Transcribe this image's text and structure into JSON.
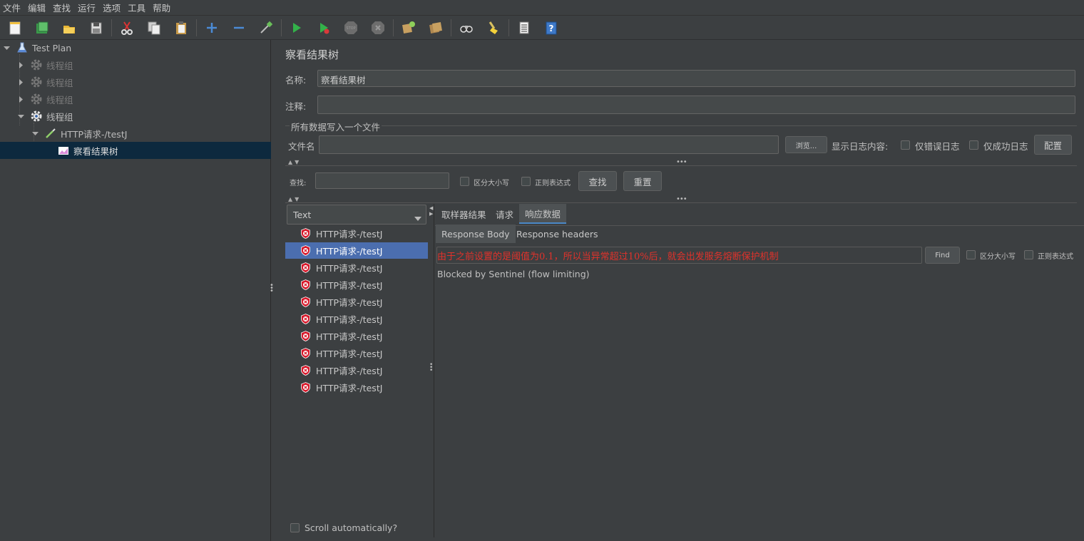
{
  "menu": [
    "文件",
    "编辑",
    "查找",
    "运行",
    "选项",
    "工具",
    "帮助"
  ],
  "toolbar_icons": [
    "new-icon",
    "templates-icon",
    "open-icon",
    "save-icon",
    "cut-icon",
    "copy-icon",
    "paste-icon",
    "expand-icon",
    "collapse-icon",
    "toggle-icon",
    "start-icon",
    "start-no-pause-icon",
    "stop-icon",
    "shutdown-icon",
    "clear-icon",
    "clear-all-icon",
    "search-icon",
    "reset-search-icon",
    "function-helper-icon",
    "help-icon"
  ],
  "tree": {
    "root": "Test Plan",
    "items": [
      {
        "label": "线程组",
        "disabled": true
      },
      {
        "label": "线程组",
        "disabled": true
      },
      {
        "label": "线程组",
        "disabled": true
      },
      {
        "label": "线程组",
        "disabled": false
      },
      {
        "label": "HTTP请求-/testJ",
        "disabled": false
      },
      {
        "label": "察看结果树",
        "disabled": false
      }
    ]
  },
  "panel": {
    "title": "察看结果树",
    "name_label": "名称:",
    "name_value": "察看结果树",
    "comment_label": "注释:",
    "comment_value": "",
    "file_section": "所有数据写入一个文件",
    "filename_label": "文件名",
    "filename_value": "",
    "browse_button": "浏览...",
    "log_label": "显示日志内容:",
    "errors_only": "仅错误日志",
    "success_only": "仅成功日志",
    "config_button": "配置",
    "search_label": "查找:",
    "search_value": "",
    "case_sensitive": "区分大小写",
    "regex": "正则表达式",
    "find_button": "查找",
    "reset_button": "重置",
    "renderer": "Text",
    "scroll_auto": "Scroll automatically?"
  },
  "results": [
    "HTTP请求-/testJ",
    "HTTP请求-/testJ",
    "HTTP请求-/testJ",
    "HTTP请求-/testJ",
    "HTTP请求-/testJ",
    "HTTP请求-/testJ",
    "HTTP请求-/testJ",
    "HTTP请求-/testJ",
    "HTTP请求-/testJ",
    "HTTP请求-/testJ"
  ],
  "selected_result": 1,
  "tabs": [
    "取样器结果",
    "请求",
    "响应数据"
  ],
  "active_tab": 2,
  "subtabs": [
    "Response Body",
    "Response headers"
  ],
  "response": {
    "find_value": "由于之前设置的是阈值为0.1，所以当异常超过10%后，就会出发服务熔断保护机制",
    "find_button": "Find",
    "case_sensitive": "区分大小写",
    "regex": "正则表达式",
    "body": "Blocked by Sentinel (flow limiting)"
  },
  "colors": {
    "background": "#3c3f41",
    "selection": "#4b6eaf",
    "tree_selection": "#0d293e",
    "annotation_red": "#e0322b",
    "error_icon": "#d7192b"
  }
}
